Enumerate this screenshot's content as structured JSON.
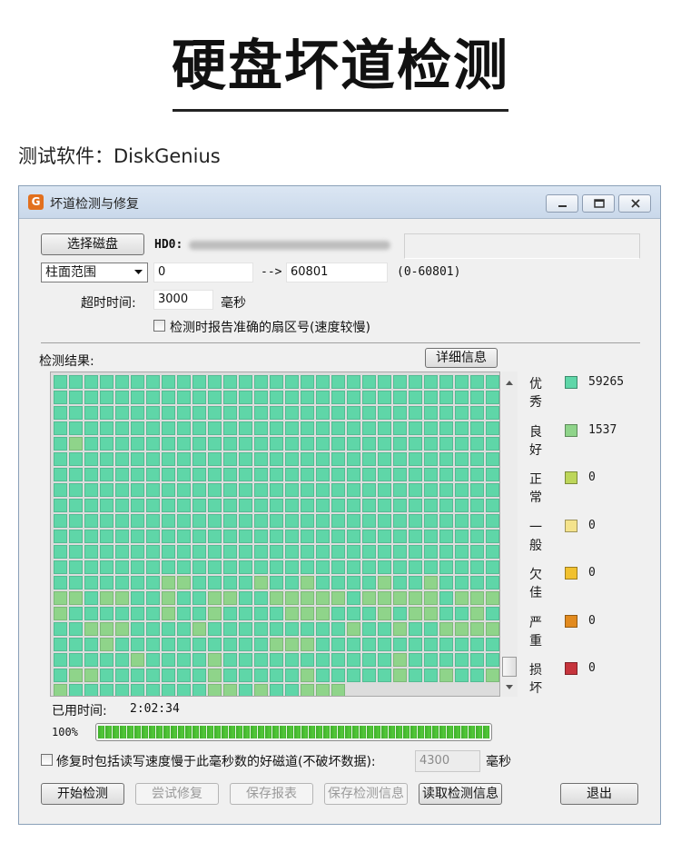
{
  "page": {
    "title": "硬盘坏道检测",
    "subtitle": "测试软件：DiskGenius"
  },
  "window": {
    "app_icon_glyph": "G",
    "title": "坏道检测与修复",
    "controls": [
      "minimize-icon",
      "maximize-icon",
      "close-icon"
    ]
  },
  "disk": {
    "select_button": "选择磁盘",
    "prefix": "HD0:"
  },
  "range": {
    "mode": "柱面范围",
    "start": "0",
    "arrow": "-->",
    "end": "60801",
    "hint": "(0-60801)"
  },
  "timeout": {
    "label": "超时时间:",
    "value": "3000",
    "unit": "毫秒"
  },
  "report_option": {
    "label": "检测时报告准确的扇区号(速度较慢)",
    "checked": false
  },
  "results": {
    "label": "检测结果:",
    "details_button": "详细信息"
  },
  "legend": [
    {
      "name": "优秀",
      "color": "#5fd6a8",
      "count": "59265"
    },
    {
      "name": "良好",
      "color": "#8fd48a",
      "count": "1537"
    },
    {
      "name": "正常",
      "color": "#bdd65a",
      "count": "0"
    },
    {
      "name": "一般",
      "color": "#f4e38c",
      "count": "0"
    },
    {
      "name": "欠佳",
      "color": "#f1c12f",
      "count": "0"
    },
    {
      "name": "严重",
      "color": "#e28a1e",
      "count": "0"
    },
    {
      "name": "损坏",
      "color": "#c6343c",
      "count": "0"
    }
  ],
  "grid": {
    "columns": 29,
    "total_cells": 599,
    "good_cells": [
      [
        4,
        1
      ],
      [
        13,
        7
      ],
      [
        13,
        8
      ],
      [
        13,
        13
      ],
      [
        13,
        16
      ],
      [
        13,
        21
      ],
      [
        13,
        24
      ],
      [
        14,
        0
      ],
      [
        14,
        1
      ],
      [
        14,
        3
      ],
      [
        14,
        4
      ],
      [
        14,
        7
      ],
      [
        14,
        10
      ],
      [
        14,
        11
      ],
      [
        14,
        14
      ],
      [
        14,
        15
      ],
      [
        14,
        16
      ],
      [
        14,
        17
      ],
      [
        14,
        18
      ],
      [
        14,
        20
      ],
      [
        14,
        21
      ],
      [
        14,
        22
      ],
      [
        14,
        23
      ],
      [
        14,
        24
      ],
      [
        14,
        26
      ],
      [
        14,
        27
      ],
      [
        14,
        28
      ],
      [
        15,
        0
      ],
      [
        15,
        7
      ],
      [
        15,
        10
      ],
      [
        15,
        15
      ],
      [
        15,
        16
      ],
      [
        15,
        17
      ],
      [
        15,
        21
      ],
      [
        15,
        23
      ],
      [
        15,
        24
      ],
      [
        15,
        27
      ],
      [
        16,
        2
      ],
      [
        16,
        3
      ],
      [
        16,
        4
      ],
      [
        16,
        9
      ],
      [
        16,
        19
      ],
      [
        16,
        22
      ],
      [
        16,
        25
      ],
      [
        16,
        26
      ],
      [
        16,
        27
      ],
      [
        16,
        28
      ],
      [
        17,
        3
      ],
      [
        17,
        14
      ],
      [
        17,
        15
      ],
      [
        17,
        16
      ],
      [
        18,
        5
      ],
      [
        18,
        10
      ],
      [
        18,
        22
      ],
      [
        19,
        1
      ],
      [
        19,
        2
      ],
      [
        19,
        10
      ],
      [
        19,
        16
      ],
      [
        19,
        22
      ],
      [
        19,
        25
      ],
      [
        19,
        28
      ],
      [
        20,
        0
      ],
      [
        20,
        10
      ],
      [
        20,
        11
      ],
      [
        20,
        13
      ],
      [
        20,
        16
      ],
      [
        20,
        17
      ],
      [
        20,
        18
      ]
    ]
  },
  "elapsed": {
    "label": "已用时间:",
    "value": "2:02:34"
  },
  "progress": {
    "label": "100%",
    "fraction": 1.0
  },
  "repair_option": {
    "label": "修复时包括读写速度慢于此毫秒数的好磁道(不破坏数据):",
    "value": "4300",
    "unit": "毫秒",
    "checked": false
  },
  "buttons": {
    "start": "开始检测",
    "repair": "尝试修复",
    "save_report": "保存报表",
    "save_info": "保存检测信息",
    "read_info": "读取检测信息",
    "exit": "退出"
  }
}
